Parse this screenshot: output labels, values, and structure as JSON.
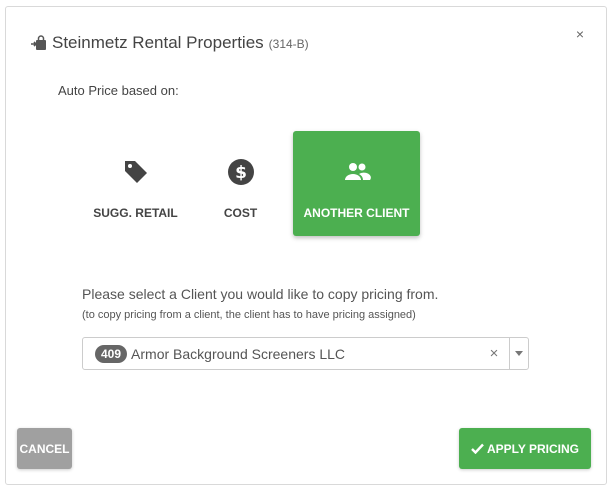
{
  "dialog": {
    "title": "Steinmetz Rental Properties",
    "code": "(314-B)",
    "close_label": "×",
    "title_icon": "shopping-bag-arrow-icon"
  },
  "auto_price_label": "Auto Price based on:",
  "options": [
    {
      "label": "SUGG. RETAIL",
      "icon": "tag-icon",
      "selected": false
    },
    {
      "label": "COST",
      "icon": "dollar-circle-icon",
      "selected": false
    },
    {
      "label": "ANOTHER CLIENT",
      "icon": "users-icon",
      "selected": true
    }
  ],
  "client_select": {
    "prompt": "Please select a Client you would like to copy pricing from.",
    "hint": "(to copy pricing from a client, the client has to have pricing assigned)",
    "badge": "409",
    "value": "Armor Background Screeners LLC",
    "clear_label": "×"
  },
  "buttons": {
    "cancel": "CANCEL",
    "apply": "APPLY PRICING"
  },
  "colors": {
    "accent": "#4caf50",
    "cancel_gray": "#a0a0a0",
    "badge_gray": "#666666"
  }
}
